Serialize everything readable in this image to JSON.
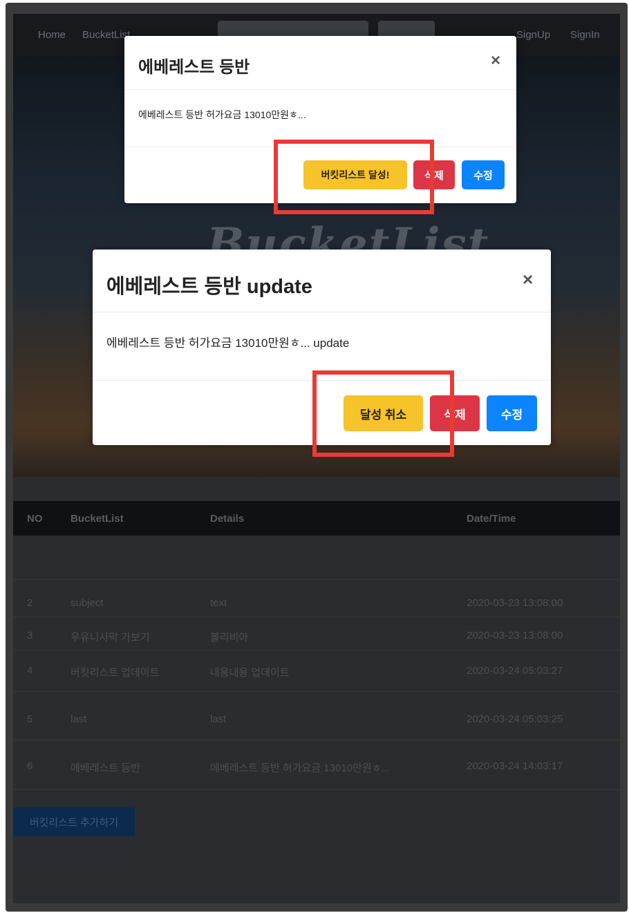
{
  "navbar": {
    "home": "Home",
    "bucketlist": "BucketList",
    "signup": "SignUp",
    "signin": "SignIn"
  },
  "hero": {
    "title": "BucketList"
  },
  "table": {
    "headers": [
      "NO",
      "BucketList",
      "Details",
      "Date/Time"
    ],
    "rows": [
      {
        "no": "2",
        "subject": "subject",
        "details": "text",
        "datetime": "2020-03-23 13:08:00"
      },
      {
        "no": "3",
        "subject": "우유니사막 가보기",
        "details": "볼리비아",
        "datetime": "2020-03-23 13:08:00"
      },
      {
        "no": "4",
        "subject": "버킷리스트 업데이트",
        "details": "내용내용 업데이트",
        "datetime": "2020-03-24 05:03:27"
      },
      {
        "no": "5",
        "subject": "last",
        "details": "last",
        "datetime": "2020-03-24 05:03:25"
      },
      {
        "no": "6",
        "subject": "에베레스트 등반",
        "details": "에베레스트 등반 허가요금 13010만원ㅎ...",
        "datetime": "2020-03-24 14:03:17"
      }
    ],
    "add_button": "버킷리스트 추가하기"
  },
  "modal_top": {
    "title": "에베레스트 등반",
    "close": "×",
    "body": "에베레스트 등반 허가요금 13010만원ㅎ...",
    "achieve_button": "버킷리스트 달성!",
    "delete_button": "삭제",
    "edit_button": "수정"
  },
  "modal_bottom": {
    "title": "에베레스트 등반 update",
    "close": "×",
    "body": "에베레스트 등반 허가요금 13010만원ㅎ... update",
    "cancel_button": "달성 취소",
    "delete_button": "삭제",
    "edit_button": "수정"
  },
  "colors": {
    "highlight": "#ea3a34",
    "warning": "#f7c32b",
    "danger": "#dc3545",
    "primary": "#0d84ff"
  }
}
